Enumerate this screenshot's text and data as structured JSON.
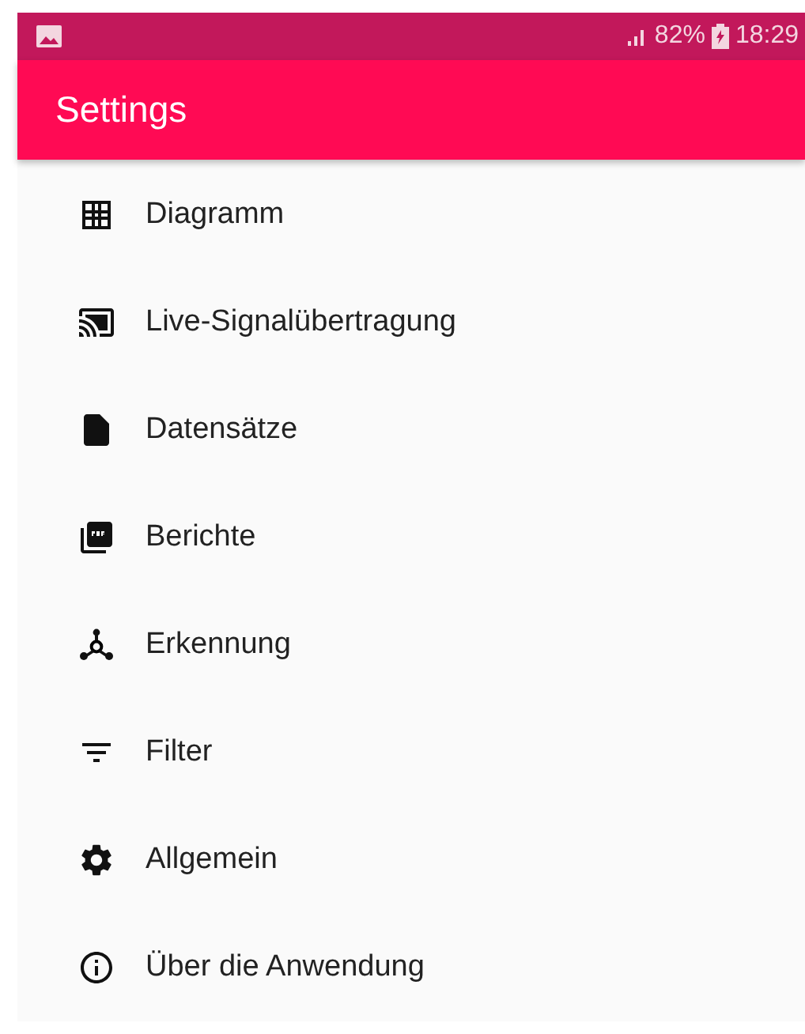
{
  "status_bar": {
    "battery": "82%",
    "time": "18:29"
  },
  "app_bar": {
    "title": "Settings"
  },
  "menu_items": [
    {
      "label": "Diagramm"
    },
    {
      "label": "Live-Signalübertragung"
    },
    {
      "label": "Datensätze"
    },
    {
      "label": "Berichte"
    },
    {
      "label": "Erkennung"
    },
    {
      "label": "Filter"
    },
    {
      "label": "Allgemein"
    },
    {
      "label": "Über die Anwendung"
    }
  ]
}
